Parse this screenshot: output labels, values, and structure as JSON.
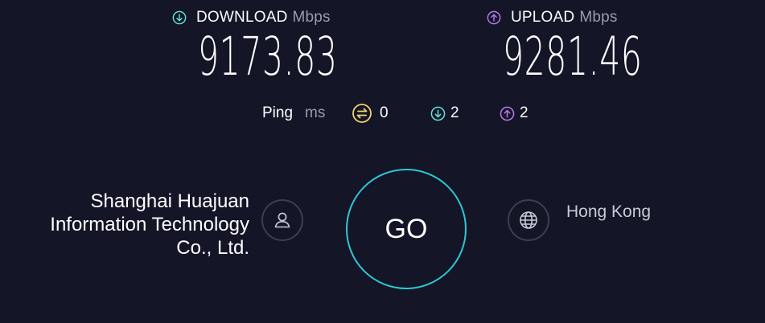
{
  "download": {
    "label": "DOWNLOAD",
    "unit": "Mbps",
    "value": "9173.83",
    "icon": "arrow-down-circle-icon",
    "color": "#5fe3d8"
  },
  "upload": {
    "label": "UPLOAD",
    "unit": "Mbps",
    "value": "9281.46",
    "icon": "arrow-up-circle-icon",
    "color": "#b57cf0"
  },
  "ping": {
    "label": "Ping",
    "unit": "ms",
    "jitter": {
      "value": "0",
      "icon": "jitter-icon",
      "color": "#f3d36b"
    },
    "download_latency": {
      "value": "2",
      "icon": "arrow-down-circle-icon",
      "color": "#5fe3d8"
    },
    "upload_latency": {
      "value": "2",
      "icon": "arrow-up-circle-icon",
      "color": "#b57cf0"
    }
  },
  "provider": {
    "lines": [
      "Shanghai Huajuan",
      "Information Technology",
      "Co., Ltd."
    ],
    "icon": "user-icon"
  },
  "go_button": {
    "label": "GO",
    "color": "#2ec7d6"
  },
  "server": {
    "location": "Hong Kong",
    "icon": "globe-icon"
  }
}
